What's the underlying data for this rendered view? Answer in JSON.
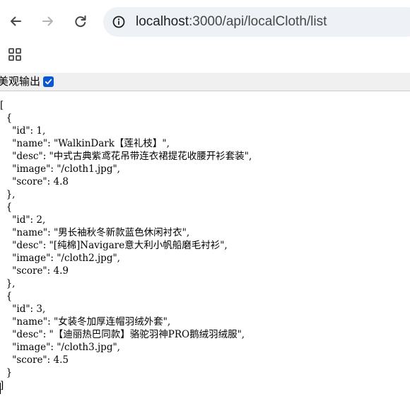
{
  "browser": {
    "back_icon": "arrow-left-icon",
    "forward_icon": "arrow-right-icon",
    "reload_icon": "reload-icon",
    "site_info_icon": "info-circle-icon",
    "url_host": "localhost",
    "url_path": ":3000/api/localCloth/list",
    "apps_icon": "apps-grid-icon"
  },
  "pretty_print": {
    "label": "美观输出",
    "checked": true,
    "accent": "#0b57d0"
  },
  "json_lines": [
    "[",
    "  {",
    "    \"id\": 1,",
    "    \"name\": \"WalkinDark【莲礼枝】\",",
    "    \"desc\": \"中式古典紫鸢花吊带连衣裙提花收腰开衫套装\",",
    "    \"image\": \"/cloth1.jpg\",",
    "    \"score\": 4.8",
    "  },",
    "  {",
    "    \"id\": 2,",
    "    \"name\": \"男长袖秋冬新款蓝色休闲衬衣\",",
    "    \"desc\": \"[纯棉]Navigare意大利小帆船磨毛衬衫\",",
    "    \"image\": \"/cloth2.jpg\",",
    "    \"score\": 4.9",
    "  },",
    "  {",
    "    \"id\": 3,",
    "    \"name\": \"女装冬加厚连帽羽绒外套\",",
    "    \"desc\": \"【迪丽热巴同款】骆驼羽神PRO鹅绒羽绒服\",",
    "    \"image\": \"/cloth3.jpg\",",
    "    \"score\": 4.5",
    "  }",
    "]"
  ]
}
